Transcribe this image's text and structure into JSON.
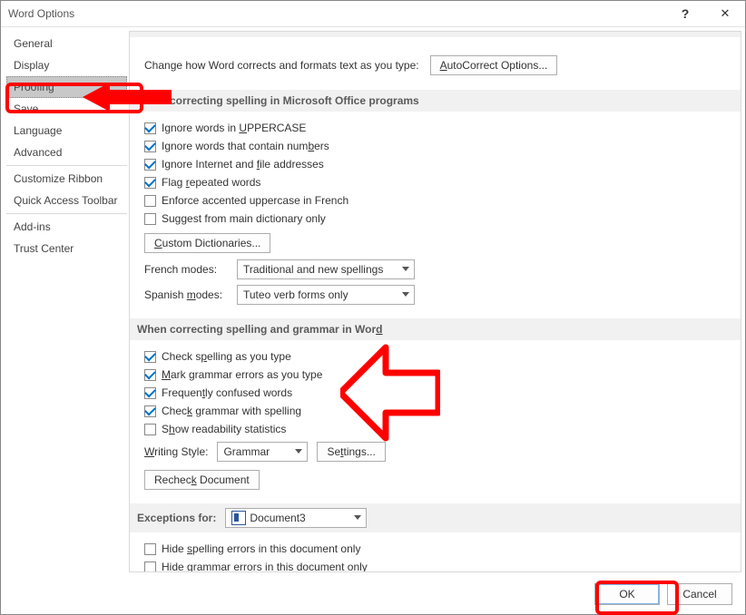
{
  "title": "Word Options",
  "sidebar": {
    "items": [
      {
        "label": "General"
      },
      {
        "label": "Display"
      },
      {
        "label": "Proofing",
        "selected": true
      },
      {
        "label": "Save"
      },
      {
        "label": "Language"
      },
      {
        "label": "Advanced"
      },
      {
        "label": "Customize Ribbon"
      },
      {
        "label": "Quick Access Toolbar"
      },
      {
        "label": "Add-ins"
      },
      {
        "label": "Trust Center"
      }
    ]
  },
  "intro": {
    "text": "Change how Word corrects and formats text as you type:",
    "button": "AutoCorrect Options..."
  },
  "section1": {
    "title": "When correcting spelling in Microsoft Office programs",
    "c1": "Ignore words in UPPERCASE",
    "c2": "Ignore words that contain numbers",
    "c3": "Ignore Internet and file addresses",
    "c4": "Flag repeated words",
    "c5": "Enforce accented uppercase in French",
    "c6": "Suggest from main dictionary only",
    "custom_dict_btn": "Custom Dictionaries...",
    "french_label": "French modes:",
    "french_value": "Traditional and new spellings",
    "spanish_label": "Spanish modes:",
    "spanish_value": "Tuteo verb forms only"
  },
  "section2": {
    "title": "When correcting spelling and grammar in Word",
    "c1": "Check spelling as you type",
    "c2": "Mark grammar errors as you type",
    "c3": "Frequently confused words",
    "c4": "Check grammar with spelling",
    "c5": "Show readability statistics",
    "writing_style_label": "Writing Style:",
    "writing_style_value": "Grammar",
    "settings_btn": "Settings...",
    "recheck_btn": "Recheck Document"
  },
  "section3": {
    "title": "Exceptions for:",
    "doc_value": "Document3",
    "c1": "Hide spelling errors in this document only",
    "c2": "Hide grammar errors in this document only"
  },
  "footer": {
    "ok": "OK",
    "cancel": "Cancel"
  }
}
